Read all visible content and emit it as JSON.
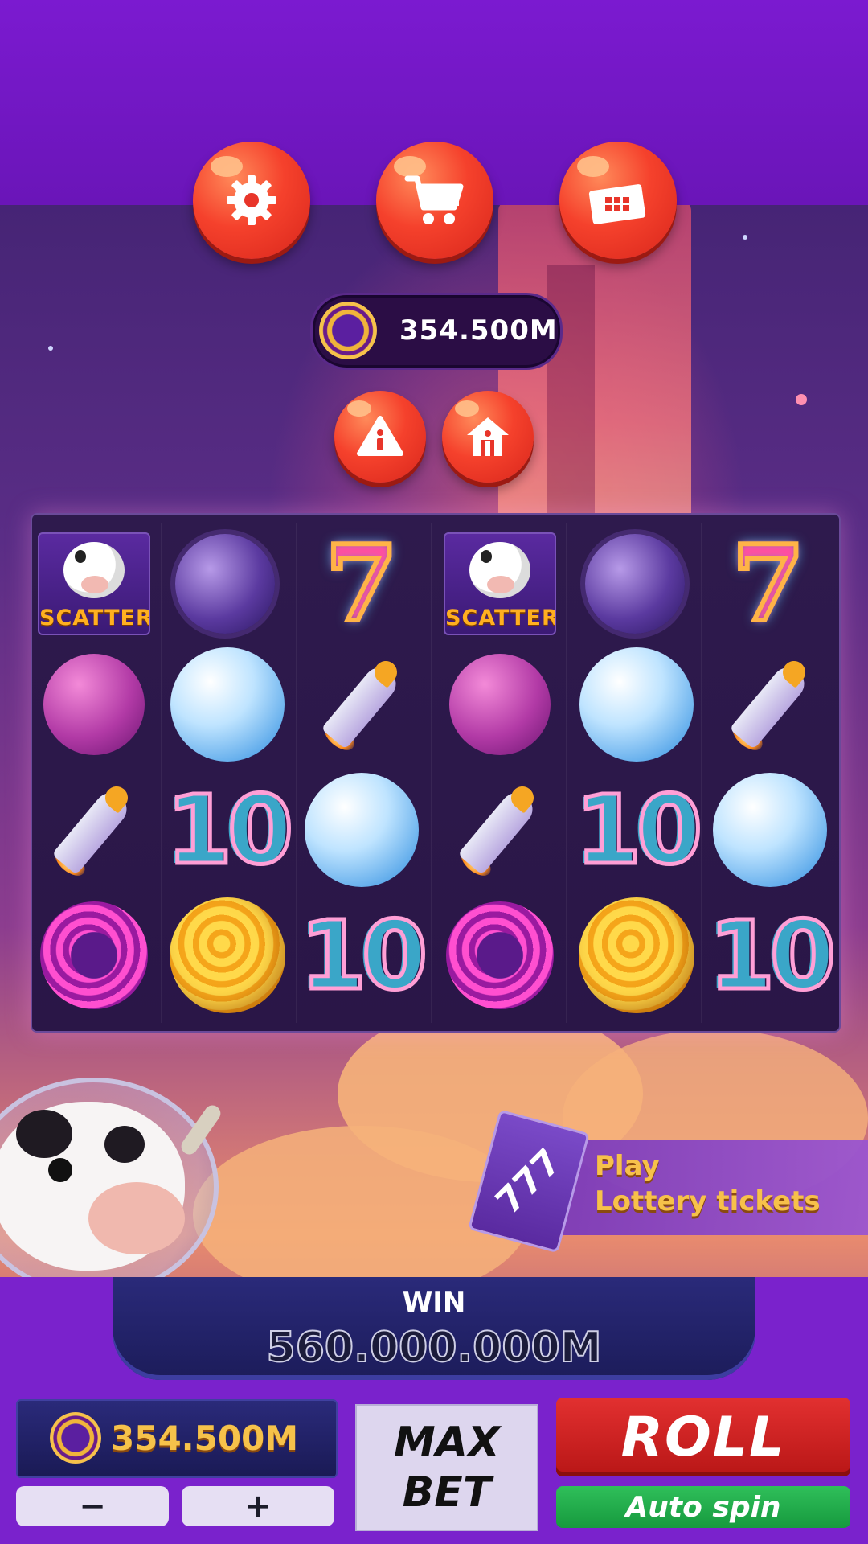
{
  "top_bar": {
    "settings_icon": "gear-icon",
    "shop_icon": "cart-icon",
    "lottery_icon": "ticket-icon"
  },
  "balance": {
    "value": "354.500M"
  },
  "secondary_buttons": {
    "info_icon": "info-icon",
    "home_icon": "home-icon"
  },
  "reels": {
    "rows": [
      [
        "scatter",
        "dark-purple-planet",
        "seven",
        "scatter",
        "dark-purple-planet",
        "seven"
      ],
      [
        "magenta-planet",
        "ice-planet",
        "rocket",
        "magenta-planet",
        "ice-planet",
        "rocket"
      ],
      [
        "rocket",
        "ten",
        "ice-planet",
        "rocket",
        "ten",
        "ice-planet"
      ],
      [
        "cage-orb",
        "gold-orb",
        "ten",
        "cage-orb",
        "gold-orb",
        "ten"
      ]
    ],
    "scatter_label": "SCATTER",
    "seven_label": "7",
    "ten_label": "10"
  },
  "lottery_banner": {
    "ticket_text": "777",
    "line1": "Play",
    "line2": "Lottery tickets"
  },
  "win": {
    "label": "WIN",
    "amount": "560.000.000M"
  },
  "bet": {
    "value": "354.500M",
    "minus": "−",
    "plus": "+"
  },
  "max_bet": {
    "line1": "MAX",
    "line2": "BET"
  },
  "roll": {
    "label": "ROLL"
  },
  "auto_spin": {
    "label": "Auto spin"
  },
  "colors": {
    "accent_red": "#e23030",
    "accent_green": "#2fbf5a",
    "gold": "#f6c24a",
    "purple": "#7a22cc"
  }
}
